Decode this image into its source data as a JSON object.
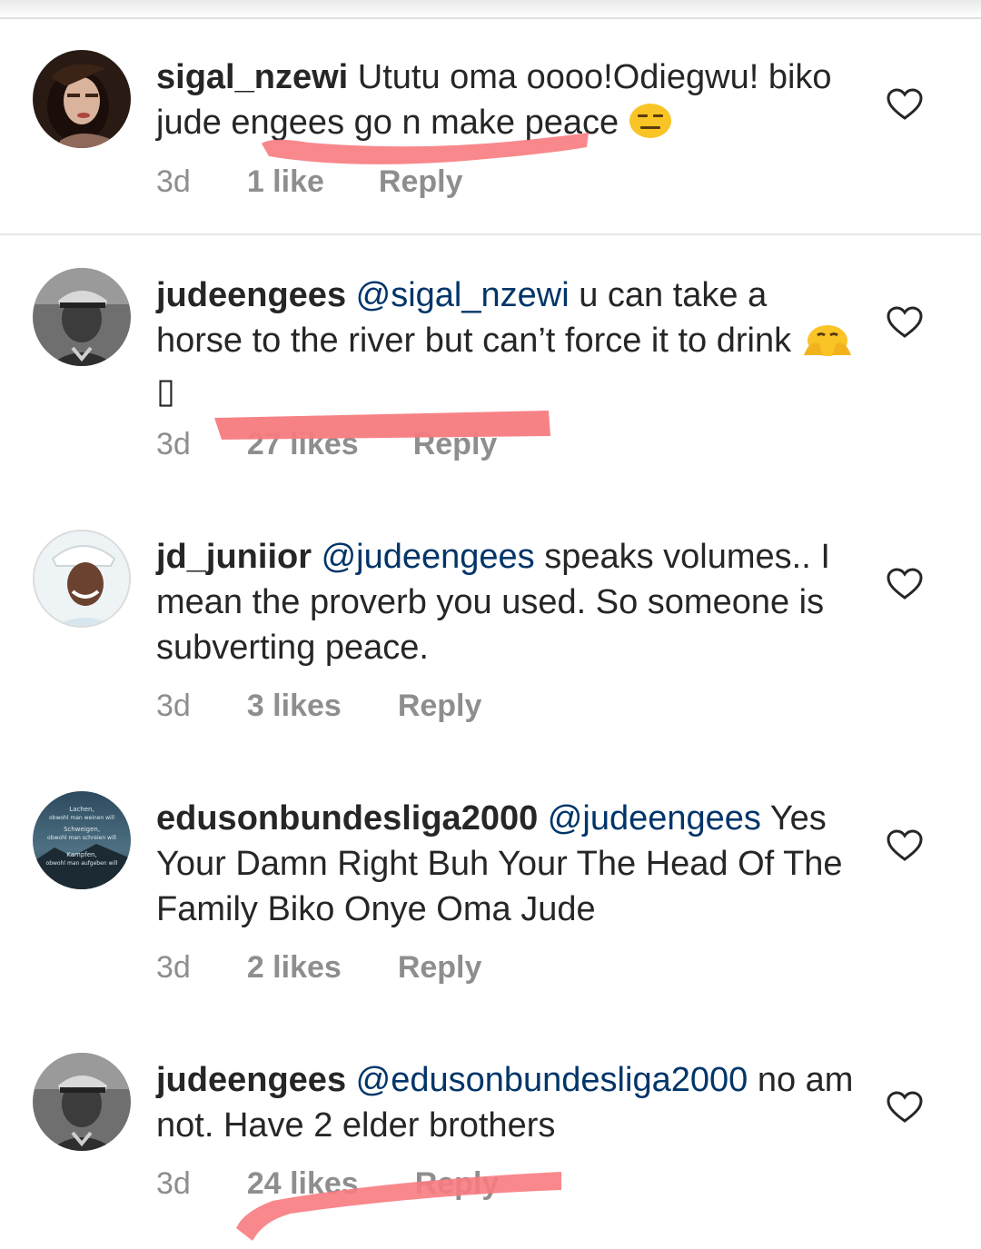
{
  "comments": [
    {
      "user": "sigal_nzewi",
      "mention": "",
      "text": "Ututu oma oooo!Odiegwu! biko jude engees go n make peace",
      "emoji": "expressionless-face",
      "time": "3d",
      "likes": "1 like",
      "reply": "Reply"
    },
    {
      "user": "judeengees",
      "mention": "@sigal_nzewi",
      "text": "u can take a horse to the river but can’t force it to drink",
      "emoji": "hands-on-face",
      "trailing": "▯",
      "time": "3d",
      "likes": "27 likes",
      "reply": "Reply"
    },
    {
      "user": "jd_juniior",
      "mention": "@judeengees",
      "text": "speaks volumes.. I mean the proverb you used. So someone is subverting peace.",
      "time": "3d",
      "likes": "3 likes",
      "reply": "Reply"
    },
    {
      "user": "edusonbundesliga2000",
      "mention": "@judeengees",
      "text": "Yes Your Damn Right Buh Your The Head Of The Family Biko Onye Oma Jude",
      "time": "3d",
      "likes": "2 likes",
      "reply": "Reply"
    },
    {
      "user": "judeengees",
      "mention": "@edusonbundesliga2000",
      "text": "no am not. Have 2 elder brothers",
      "time": "3d",
      "likes": "24 likes",
      "reply": "Reply"
    }
  ],
  "avatar4_text": [
    "Lachen,",
    "obwohl man weinen will",
    "Schweigen,",
    "obwohl man schreien will",
    "Kampfen,",
    "obwohl man aufgeben will"
  ],
  "colors": {
    "text": "#262626",
    "mention": "#003569",
    "meta": "#8e8e8e",
    "highlight": "#f77b7f",
    "heart": "#262626"
  }
}
